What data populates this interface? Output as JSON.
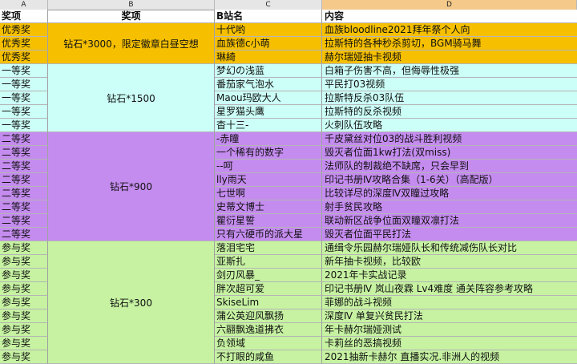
{
  "colors": {
    "header": "#ffffff",
    "excellent": "#f6c000",
    "first": "#ccfff8",
    "second": "#c58cf0",
    "participation": "#c6f2a2"
  },
  "column_letters": [
    "A",
    "B",
    "C",
    "D"
  ],
  "header": {
    "a": "奖项",
    "b": "奖项",
    "c": "B站名",
    "d": "内容"
  },
  "groups": [
    {
      "tier": "excellent",
      "prize": "钻石*3000，限定徽章白昼空想",
      "rows": [
        {
          "award": "优秀奖",
          "name": "十代哟",
          "content": "血族bloodline2021拜年祭个人向"
        },
        {
          "award": "优秀奖",
          "name": "血族德c小萌",
          "content": "拉斯特的各种秒杀剪切，BGM骑马舞"
        },
        {
          "award": "优秀奖",
          "name": "琳綺",
          "content": "赫尔瑞娅抽卡视频"
        }
      ]
    },
    {
      "tier": "first",
      "prize": "钻石*1500",
      "rows": [
        {
          "award": "一等奖",
          "name": "梦幻の浅蓝",
          "content": "白箱子伤害不高，但侮辱性极强"
        },
        {
          "award": "一等奖",
          "name": "番茄家气泡水",
          "content": "平民打03视频"
        },
        {
          "award": "一等奖",
          "name": "Maou玛欧大人",
          "content": "拉斯特反杀03队伍"
        },
        {
          "award": "一等奖",
          "name": "星罗猫头鹰",
          "content": "拉斯特的反杀视频"
        },
        {
          "award": "一等奖",
          "name": "杳十三-",
          "content": "火刺队伍攻略"
        }
      ]
    },
    {
      "tier": "second",
      "prize": "钻石*900",
      "rows": [
        {
          "award": "二等奖",
          "name": "-赤瞳",
          "content": "千皮黛丝对位03的战斗胜利视频"
        },
        {
          "award": "二等奖",
          "name": "一个稀有的数字",
          "content": "毁灭者位面1kw打法(双miss)"
        },
        {
          "award": "二等奖",
          "name": "--呵",
          "content": "法师队的制裁绝不缺席，只会早到"
        },
        {
          "award": "二等奖",
          "name": "lly雨天",
          "content": "印记书册Ⅳ攻略合集（1-6关）（高配版）"
        },
        {
          "award": "二等奖",
          "name": "七世啊",
          "content": "比较详尽的深度Ⅳ双瞳过攻略"
        },
        {
          "award": "二等奖",
          "name": "史蒂文博士",
          "content": "射手贫民攻略"
        },
        {
          "award": "二等奖",
          "name": "瞿衍星誓",
          "content": "联动新区战争位面双瞳双凛打法"
        },
        {
          "award": "二等奖",
          "name": "只有六硬币的派大星",
          "content": "毁灭者位面平民打法"
        }
      ]
    },
    {
      "tier": "participation",
      "prize": "钻石*300",
      "rows": [
        {
          "award": "参与奖",
          "name": "落泪宅宅",
          "content": "通缉令乐园赫尔瑞娅队长和传统减伤队长对比"
        },
        {
          "award": "参与奖",
          "name": "亚斯扎",
          "content": "新年抽卡视频，比较欧"
        },
        {
          "award": "参与奖",
          "name": "剑刃风暴_",
          "content": "2021年卡实战记录"
        },
        {
          "award": "参与奖",
          "name": "胖次超可爱",
          "content": "印记书册Ⅳ 岚山夜霖 Lv4难度 通关阵容参考攻略"
        },
        {
          "award": "参与奖",
          "name": "SkiseLim",
          "content": "菲娜的战斗视频"
        },
        {
          "award": "参与奖",
          "name": "蒲公英迎风飘扬",
          "content": "深度Ⅳ 单复兴贫民打法"
        },
        {
          "award": "参与奖",
          "name": "六翮飘逸道拂衣",
          "content": "年卡赫尔瑞娅测试"
        },
        {
          "award": "参与奖",
          "name": "负领域",
          "content": "卡莉丝的恶搞视频"
        },
        {
          "award": "参与奖",
          "name": "不打眼的咸鱼",
          "content": "2021抽新卡赫尔 直播实况.非洲人的视频"
        }
      ]
    }
  ]
}
